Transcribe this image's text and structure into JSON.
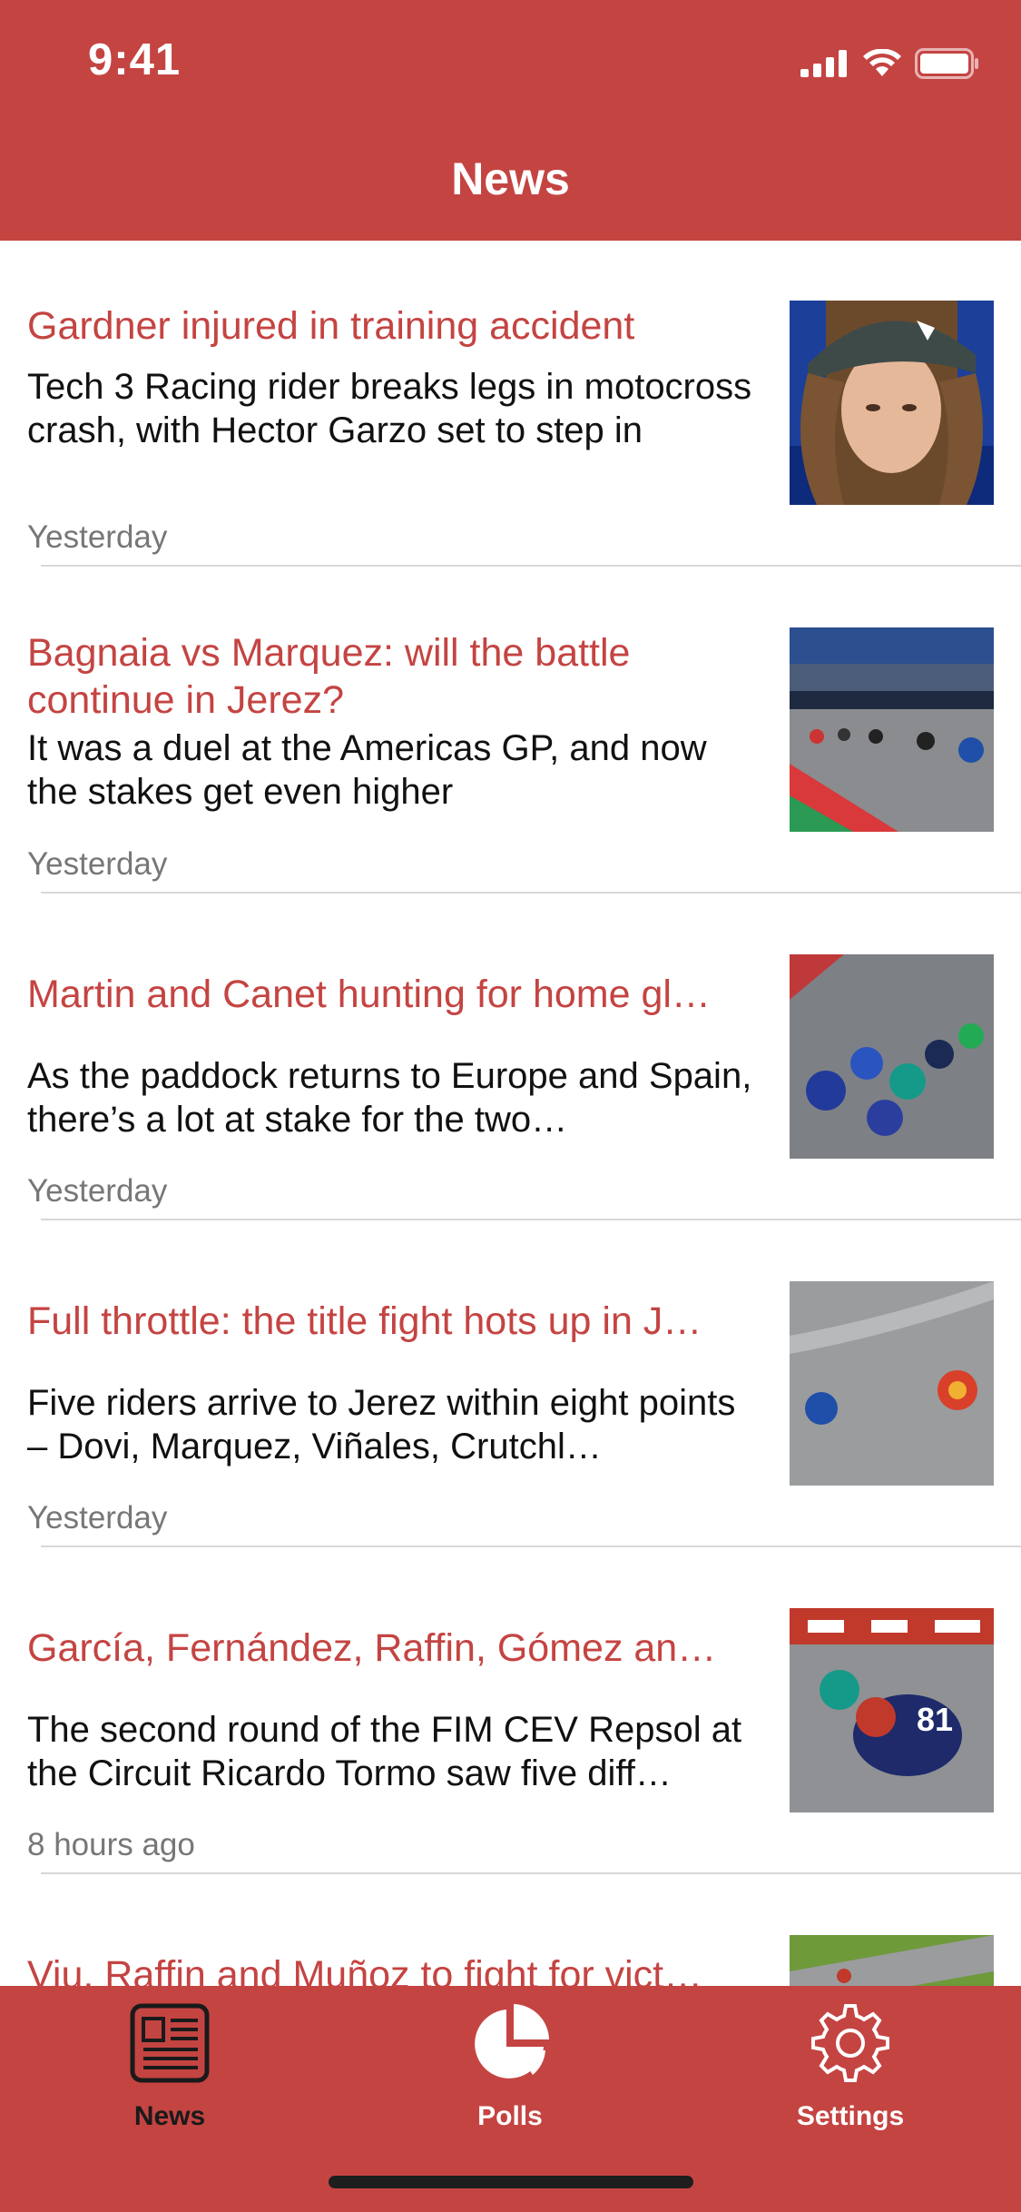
{
  "status": {
    "time": "9:41"
  },
  "nav": {
    "title": "News"
  },
  "articles": [
    {
      "title": "Gardner injured in training accident",
      "summary": "Tech 3 Racing rider breaks legs in motocross crash, with Hector Garzo set to step in",
      "time": "Yesterday",
      "image": "rider-portrait"
    },
    {
      "title": "Bagnaia vs Marquez: will the battle continue in Jerez?",
      "summary": "It was a duel at the Americas GP, and now the stakes get even higher",
      "time": "Yesterday",
      "image": "race-start-grid"
    },
    {
      "title": "Martin and Canet hunting for home gl…",
      "summary": "As the paddock returns to Europe and Spain, there’s a lot at stake for the two…",
      "time": "Yesterday",
      "image": "riders-pack-corner"
    },
    {
      "title": "Full throttle: the title fight hots up in J…",
      "summary": "Five riders arrive to Jerez within eight points – Dovi, Marquez, Viñales, Crutchl…",
      "time": "Yesterday",
      "image": "two-riders-track"
    },
    {
      "title": "García, Fernández, Raffin, Gómez an…",
      "summary": "The second round of the FIM CEV Repsol at the Circuit Ricardo Tormo saw five diff…",
      "time": "8 hours ago",
      "image": "rider-81-leaning"
    },
    {
      "title": "Viu, Raffin and Muñoz to fight for vict…",
      "summary": "",
      "time": "",
      "image": "track-grass"
    }
  ],
  "tabs": [
    {
      "label": "News",
      "icon": "newspaper-icon",
      "active": true
    },
    {
      "label": "Polls",
      "icon": "pie-chart-icon",
      "active": false
    },
    {
      "label": "Settings",
      "icon": "gear-icon",
      "active": false
    }
  ],
  "colors": {
    "brand": "#c44442",
    "active_tab": "#1a1a1a",
    "inactive_tab": "#ffffff"
  }
}
